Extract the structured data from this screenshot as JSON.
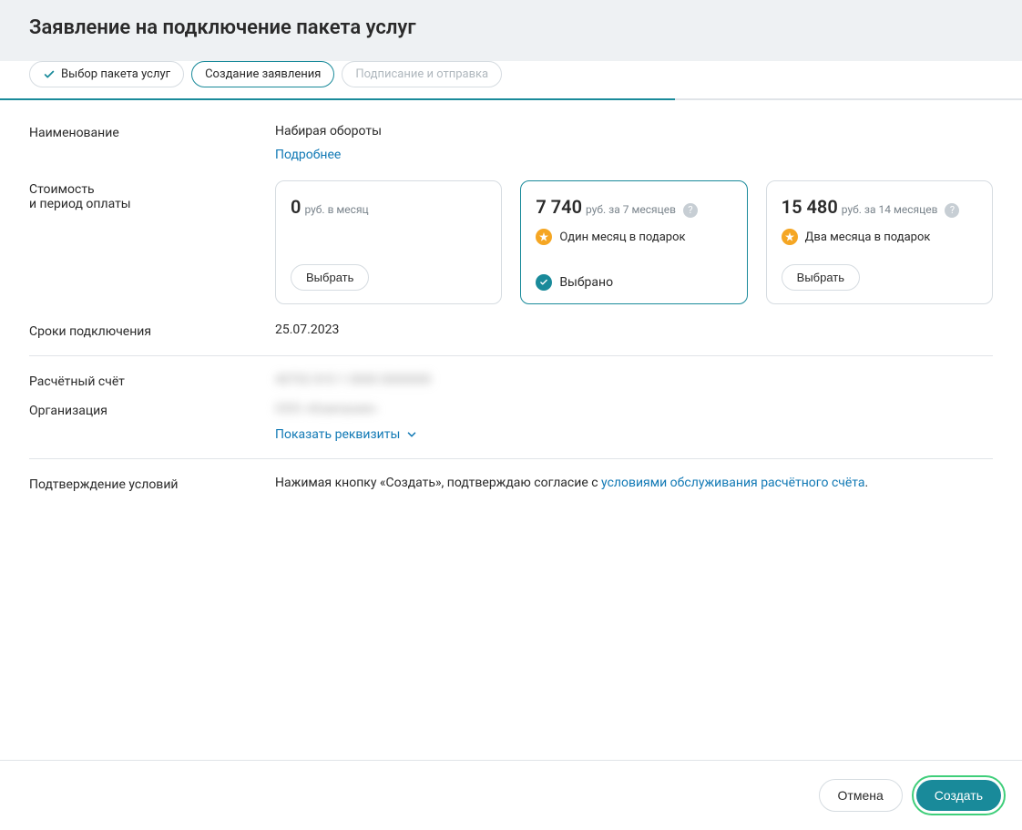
{
  "header": {
    "title": "Заявление на подключение пакета услуг"
  },
  "stepper": {
    "steps": [
      {
        "label": "Выбор пакета услуг",
        "state": "done"
      },
      {
        "label": "Создание заявления",
        "state": "current"
      },
      {
        "label": "Подписание и отправка",
        "state": "pending"
      }
    ]
  },
  "fields": {
    "name_label": "Наименование",
    "name_value": "Набирая обороты",
    "details_link": "Подробнее",
    "price_label_line1": "Стоимость",
    "price_label_line2": "и период оплаты",
    "connection_date_label": "Сроки подключения",
    "connection_date_value": "25.07.2023",
    "account_label": "Расчётный счёт",
    "account_value": "40702 810 1 0000 0000000",
    "org_label": "Организация",
    "org_value": "ООО «Компания»",
    "show_requisites": "Показать реквизиты",
    "confirmation_label": "Подтверждение условий",
    "confirmation_prefix": "Нажимая кнопку «Создать», подтверждаю согласие с ",
    "confirmation_link": "условиями обслуживания расчётного счёта",
    "confirmation_suffix": "."
  },
  "plans": [
    {
      "amount": "0",
      "unit": "руб. в месяц",
      "bonus": null,
      "selected": false,
      "select_label": "Выбрать",
      "has_help": false
    },
    {
      "amount": "7 740",
      "unit": "руб. за 7 месяцев",
      "bonus": "Один месяц в подарок",
      "selected": true,
      "chosen_label": "Выбрано",
      "has_help": true
    },
    {
      "amount": "15 480",
      "unit": "руб. за 14 месяцев",
      "bonus": "Два месяца в подарок",
      "selected": false,
      "select_label": "Выбрать",
      "has_help": true
    }
  ],
  "footer": {
    "cancel": "Отмена",
    "submit": "Создать"
  }
}
